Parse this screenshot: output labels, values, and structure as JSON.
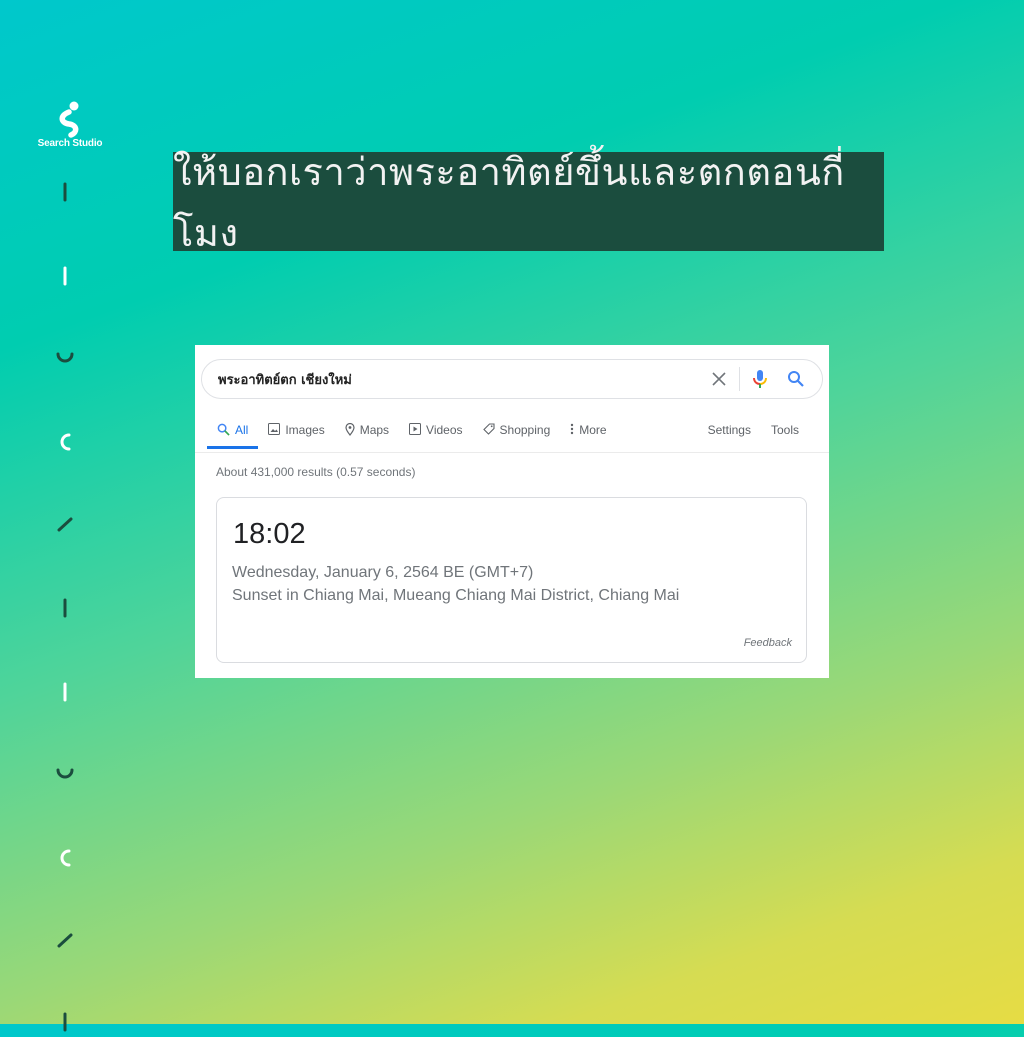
{
  "brand": {
    "name": "Search Studio"
  },
  "banner": {
    "text": "ให้บอกเราว่าพระอาทิตย์ขึ้นและตกตอนกี่โมง"
  },
  "decorations": [
    {
      "shape": "vertical-bar",
      "color": "dark"
    },
    {
      "shape": "vertical-bar",
      "color": "white"
    },
    {
      "shape": "u-arc",
      "color": "dark"
    },
    {
      "shape": "c-arc",
      "color": "white"
    },
    {
      "shape": "slash",
      "color": "dark"
    },
    {
      "shape": "vertical-bar",
      "color": "dark"
    },
    {
      "shape": "vertical-bar",
      "color": "white"
    },
    {
      "shape": "u-arc",
      "color": "dark"
    },
    {
      "shape": "c-arc",
      "color": "white"
    },
    {
      "shape": "slash",
      "color": "dark"
    },
    {
      "shape": "vertical-bar",
      "color": "dark"
    }
  ],
  "colors": {
    "dark": "#1b4d3e",
    "white": "#ffffff",
    "google_blue": "#1a73e8"
  },
  "search": {
    "query": "พระอาทิตย์ตก เชียงใหม่",
    "clear_icon": "close-icon",
    "voice_icon": "microphone-icon",
    "search_icon": "search-icon"
  },
  "tabs": [
    {
      "label": "All",
      "icon": "search-icon",
      "active": true
    },
    {
      "label": "Images",
      "icon": "image-icon"
    },
    {
      "label": "Maps",
      "icon": "map-pin-icon"
    },
    {
      "label": "Videos",
      "icon": "video-icon"
    },
    {
      "label": "Shopping",
      "icon": "tag-icon"
    },
    {
      "label": "More",
      "icon": "more-vertical-icon"
    }
  ],
  "tools": {
    "settings": "Settings",
    "tools": "Tools"
  },
  "stats": "About 431,000 results (0.57 seconds)",
  "answer": {
    "time": "18:02",
    "date": "Wednesday, January 6, 2564 BE (GMT+7)",
    "location": "Sunset in Chiang Mai, Mueang Chiang Mai District, Chiang Mai",
    "feedback": "Feedback"
  }
}
